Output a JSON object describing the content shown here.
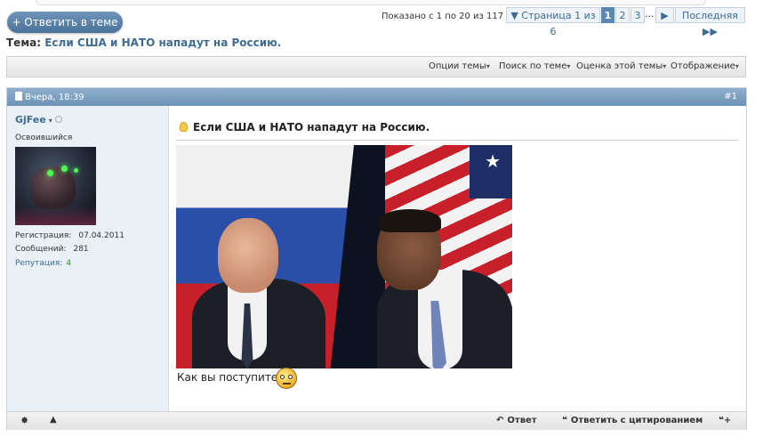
{
  "header": {
    "reply_button": "+ Ответить в теме",
    "shown_text": "Показано с 1 по 20 из 117",
    "pagination": {
      "page_label": "▼ Страница 1 из 6",
      "pages": [
        "1",
        "2",
        "3"
      ],
      "ellipsis": "...",
      "next": "▶",
      "last": "Последняя ▶▶"
    }
  },
  "thread": {
    "label": "Тема:",
    "title": "Если США и НАТО нападут на Россию."
  },
  "toolbar": {
    "items": [
      "Опции темы",
      "Поиск по теме",
      "Оценка этой темы",
      "Отображение"
    ],
    "arrow": "▾"
  },
  "post": {
    "date": "Вчера, 18:39",
    "number": "#1",
    "user": {
      "name": "GjFee",
      "dropdown": "▾",
      "title": "Освоившийся",
      "reg_label": "Регистрация:",
      "reg_value": "07.04.2011",
      "msgs_label": "Сообщений:",
      "msgs_value": "281",
      "rep_label": "Репутация:",
      "rep_value": "4"
    },
    "title": "Если США и НАТО нападут на Россию.",
    "caption": "Как вы поступите."
  },
  "footer": {
    "reply": "Ответ",
    "reply_icon": "↶",
    "quote": "Ответить с цитированием",
    "quote_icon": "❝",
    "multi_icon": "❝+",
    "star_icon": "✸",
    "warn_icon": "▲"
  },
  "colors": {
    "accent": "#3e6b94",
    "post_header": "#7a9dbf",
    "user_bg": "#e9f0f6",
    "reputation": "#2c8f2c"
  }
}
